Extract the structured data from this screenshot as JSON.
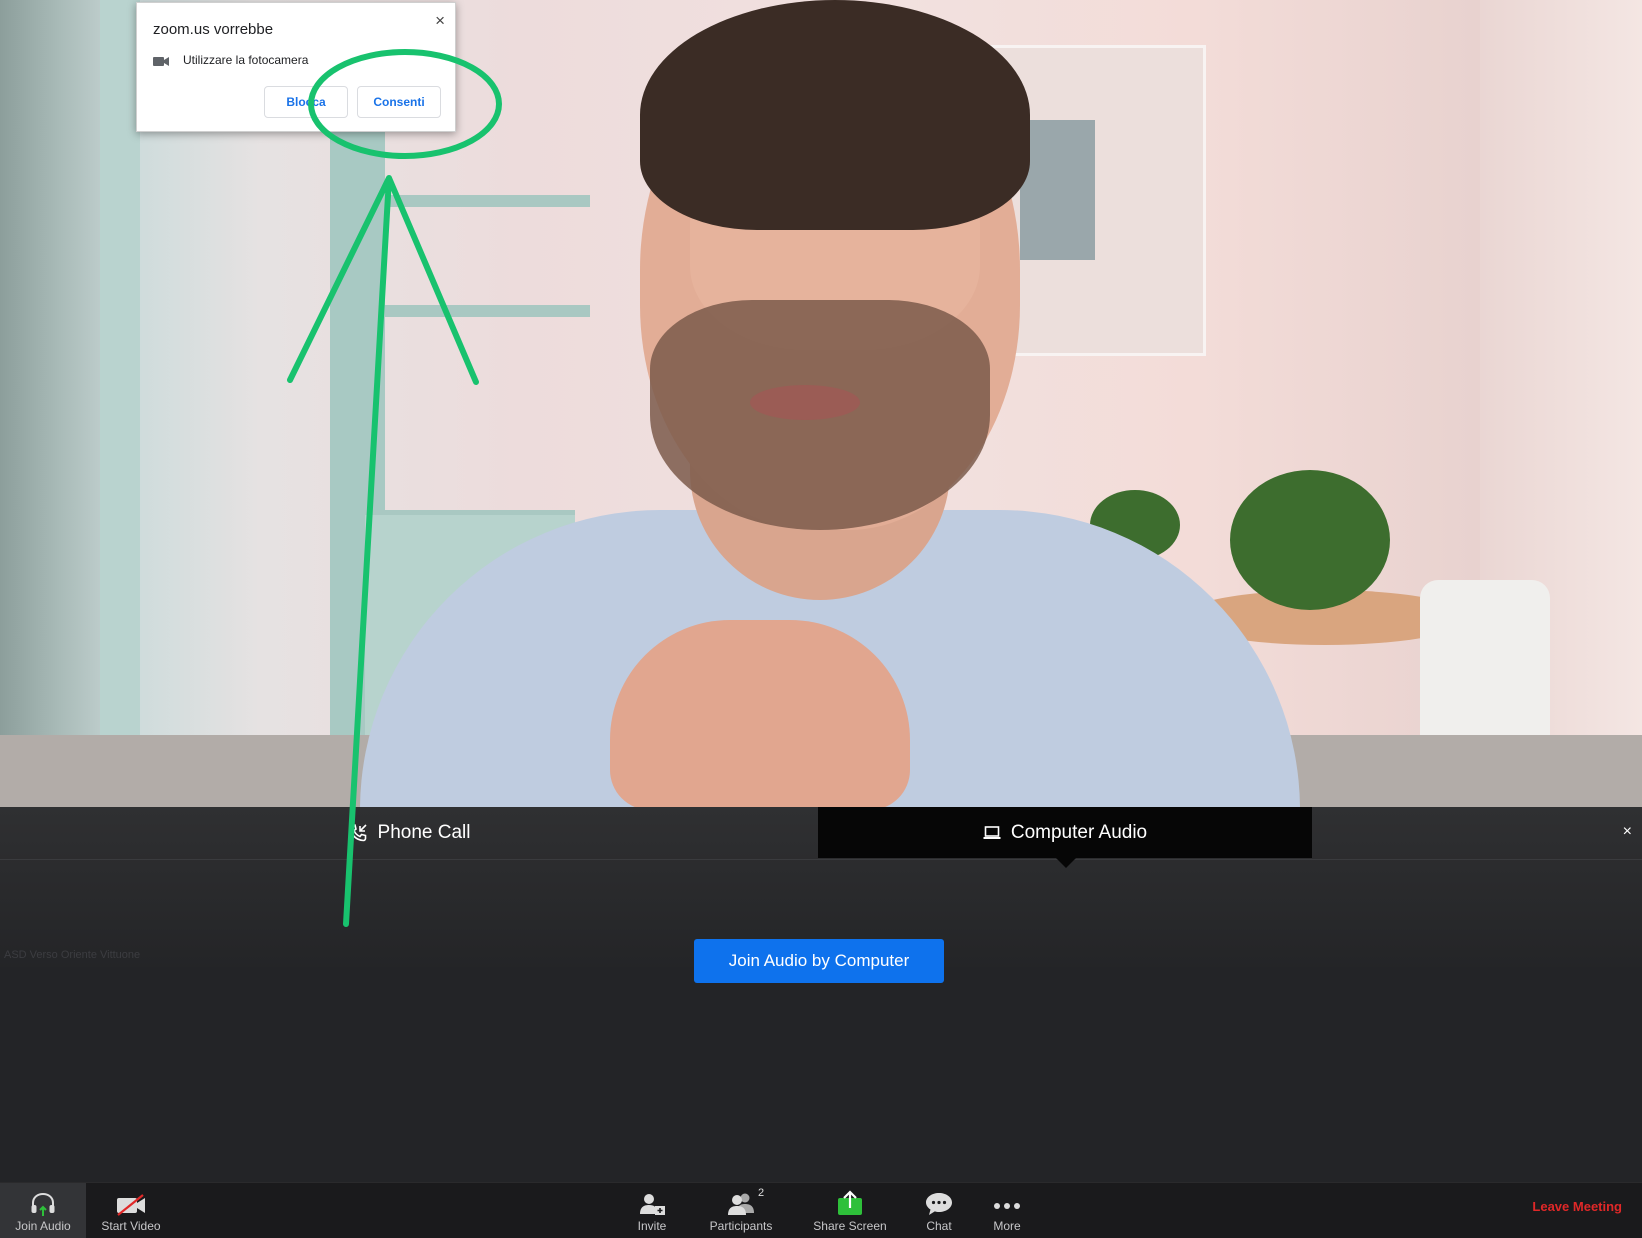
{
  "permission_popup": {
    "title": "zoom.us vorrebbe",
    "permission_text": "Utilizzare la fotocamera",
    "block_label": "Blocca",
    "allow_label": "Consenti",
    "close_symbol": "×"
  },
  "audio_panel": {
    "tabs": [
      {
        "label": "Phone Call",
        "icon": "phone-icon",
        "active": false
      },
      {
        "label": "Computer Audio",
        "icon": "laptop-icon",
        "active": true
      }
    ],
    "close_symbol": "×",
    "join_button_label": "Join Audio by Computer",
    "meeting_name": "ASD Verso Oriente Vittuone"
  },
  "toolbar": {
    "join_audio_label": "Join Audio",
    "start_video_label": "Start Video",
    "invite_label": "Invite",
    "participants_label": "Participants",
    "participants_count": "2",
    "share_screen_label": "Share Screen",
    "chat_label": "Chat",
    "more_label": "More",
    "leave_label": "Leave Meeting"
  },
  "colors": {
    "primary_button": "#0e72ed",
    "leave": "#e02828",
    "annotation": "#18c26e",
    "share_screen": "#2ec03a"
  }
}
